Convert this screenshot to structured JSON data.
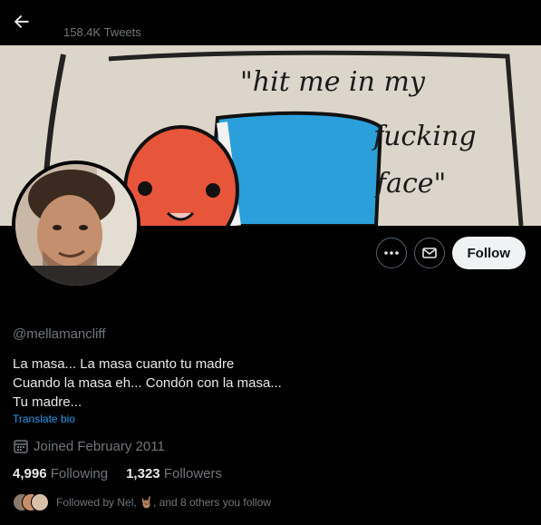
{
  "header": {
    "tweets_count": "158.4K Tweets"
  },
  "banner": {
    "quote_line1": "\"hit me in my",
    "quote_line2": "fucking",
    "quote_line3": "face\""
  },
  "actions": {
    "follow_label": "Follow"
  },
  "profile": {
    "handle": "@mellamancliff",
    "bio": [
      "La masa... La masa cuanto tu madre",
      "Cuando la masa eh... Condón con la masa...",
      "Tu madre..."
    ],
    "translate_label": "Translate bio",
    "joined": "Joined February 2011",
    "following_count": "4,996",
    "following_label": "Following",
    "followers_count": "1,323",
    "followers_label": "Followers",
    "followed_by": "Followed by Nel, 🤘🏽, and 8 others you follow"
  },
  "colors": {
    "accent": "#1d9bf0",
    "muted": "#71767b",
    "text": "#e7e9ea"
  }
}
